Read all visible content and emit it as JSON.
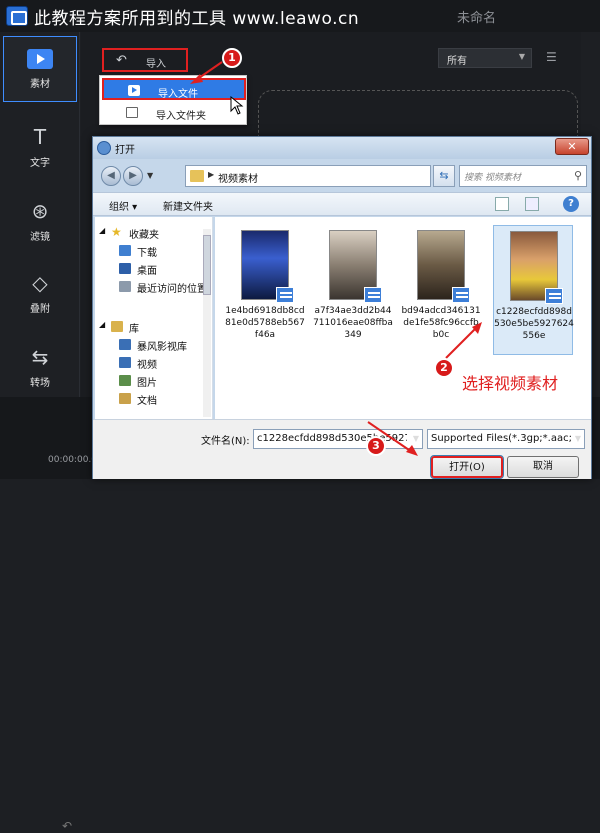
{
  "watermark": {
    "text": "此教程方案所用到的工具 www.leawo.cn"
  },
  "app": {
    "doc_title": "未命名"
  },
  "sidebar": {
    "items": [
      {
        "label": "素材",
        "icon": "media-icon"
      },
      {
        "label": "文字",
        "icon": "text-icon"
      },
      {
        "label": "滤镜",
        "icon": "filter-icon"
      },
      {
        "label": "叠附",
        "icon": "overlay-icon"
      },
      {
        "label": "转场",
        "icon": "transition-icon"
      }
    ]
  },
  "toolbar": {
    "import_label": "导入",
    "filter_value": "所有"
  },
  "import_menu": {
    "items": [
      {
        "label": "导入文件"
      },
      {
        "label": "导入文件夹"
      }
    ]
  },
  "timeline": {
    "time": "00:00:00.0"
  },
  "dialog": {
    "title": "打开",
    "path": "视频素材",
    "search_placeholder": "搜索 视频素材",
    "organize_label": "组织 ▾",
    "new_folder_label": "新建文件夹",
    "nav_items": [
      {
        "label": "收藏夹"
      },
      {
        "label": "下载"
      },
      {
        "label": "桌面"
      },
      {
        "label": "最近访问的位置"
      },
      {
        "label": "库"
      },
      {
        "label": "暴风影视库"
      },
      {
        "label": "视频"
      },
      {
        "label": "图片"
      },
      {
        "label": "文档"
      }
    ],
    "files": [
      {
        "name": "1e4bd6918db8cd81e0d5788eb567f46a"
      },
      {
        "name": "a7f34ae3dd2b44711016eae08ffba349"
      },
      {
        "name": "bd94adcd346131de1fe58fc96ccfbb0c"
      },
      {
        "name": "c1228ecfdd898d530e5be5927624556e"
      }
    ],
    "filename_label": "文件名(N):",
    "filename_value": "c1228ecfdd898d530e5be5927",
    "filetype_value": "Supported Files(*.3gp;*.aac;*",
    "open_label": "打开(O)",
    "cancel_label": "取消"
  },
  "annotations": {
    "badge1": "1",
    "badge2": "2",
    "badge3": "3",
    "text": "选择视频素材"
  },
  "colors": {
    "accent": "#2f7be5",
    "annotation_red": "#e02020"
  }
}
